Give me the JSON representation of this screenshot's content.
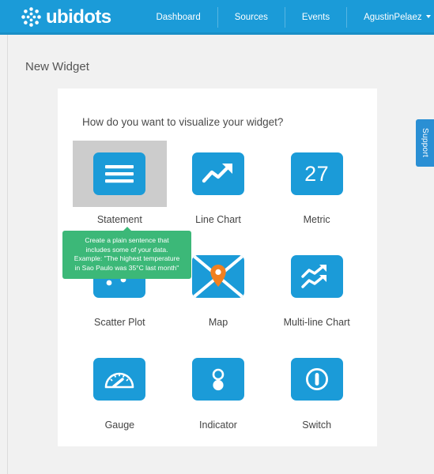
{
  "navbar": {
    "brand": "ubidots",
    "logo_icon": "ubidots-dots-logo",
    "items": [
      {
        "label": "Dashboard",
        "name": "dashboard"
      },
      {
        "label": "Sources",
        "name": "sources"
      },
      {
        "label": "Events",
        "name": "events"
      }
    ],
    "user": {
      "label": "AgustinPelaez",
      "caret_icon": "chevron-down-icon"
    }
  },
  "page": {
    "title": "New Widget",
    "question": "How do you want to visualize your widget?"
  },
  "widgets": [
    {
      "label": "Statement",
      "icon": "statement-icon",
      "selected": true
    },
    {
      "label": "Line Chart",
      "icon": "line-chart-icon",
      "selected": false
    },
    {
      "label": "Metric",
      "icon": "metric-icon",
      "selected": false,
      "value": "27"
    },
    {
      "label": "Scatter Plot",
      "icon": "scatter-plot-icon",
      "selected": false
    },
    {
      "label": "Map",
      "icon": "map-icon",
      "selected": false
    },
    {
      "label": "Multi-line Chart",
      "icon": "multi-line-chart-icon",
      "selected": false
    },
    {
      "label": "Gauge",
      "icon": "gauge-icon",
      "selected": false
    },
    {
      "label": "Indicator",
      "icon": "indicator-icon",
      "selected": false
    },
    {
      "label": "Switch",
      "icon": "switch-icon",
      "selected": false
    }
  ],
  "tooltip": {
    "line1": "Create a plain sentence that",
    "line2": "includes some of your data.",
    "line3": "Example: \"The highest temperature",
    "line4": "in Sao Paulo was 35°C last month\""
  },
  "support": {
    "label": "Support"
  },
  "colors": {
    "brand_blue": "#1b9bd8",
    "tooltip_green": "#3cb878",
    "support_blue": "#2a8fd4",
    "selected_gray": "#cccccc",
    "page_bg": "#f1f1f1",
    "map_pin_orange": "#f08020"
  }
}
